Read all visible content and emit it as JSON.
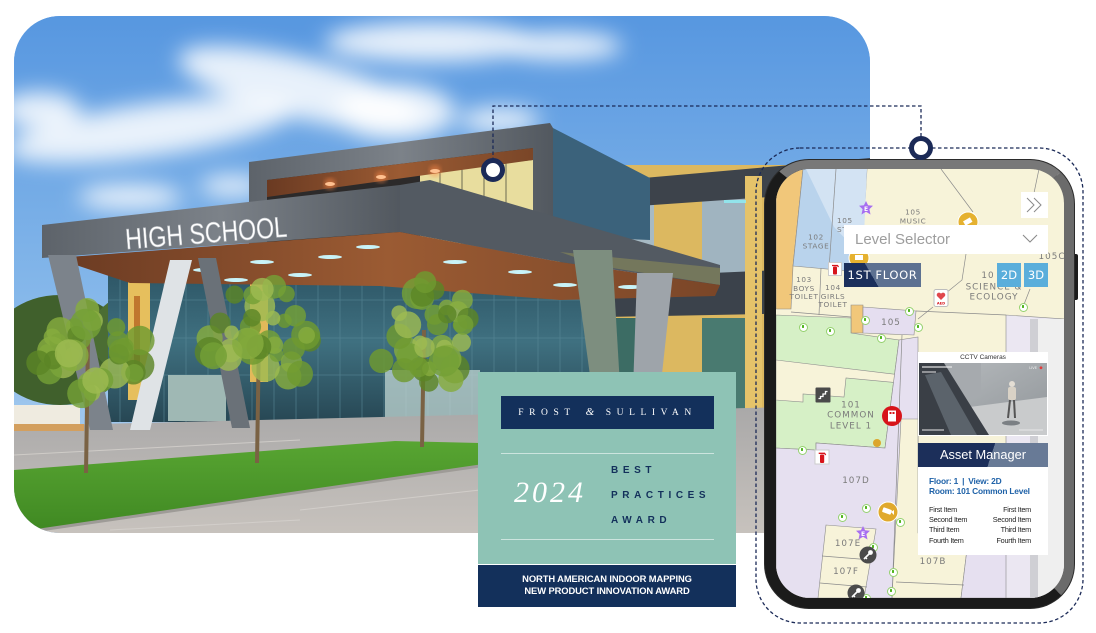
{
  "colors": {
    "navy": "#13305b",
    "award_teal": "#8ec3b5",
    "map_blue": "#5aaedb",
    "connector": "#1b2a57"
  },
  "photo": {
    "sign_text": "HIGH SCHOOL"
  },
  "award": {
    "brand": {
      "left": "FROST",
      "amp": "&",
      "right": "SULLIVAN"
    },
    "year": "2024",
    "title_lines": [
      "BEST",
      "PRACTICES",
      "AWARD"
    ],
    "category_lines": [
      "NORTH AMERICAN INDOOR MAPPING",
      "NEW PRODUCT INNOVATION AWARD"
    ]
  },
  "phone": {
    "level_selector": {
      "placeholder": "Level Selector"
    },
    "current_floor": "1ST FLOOR",
    "view_toggle": [
      {
        "label": "2D"
      },
      {
        "label": "3D"
      }
    ],
    "map": {
      "rooms": [
        {
          "label": "102\nSTAGE"
        },
        {
          "label": "105\nST"
        },
        {
          "label": "105\nMUSIC"
        },
        {
          "label": "103\nBOYS\nTOILET"
        },
        {
          "label": "104\nGIRLS\nTOILET"
        },
        {
          "label": "10"
        },
        {
          "label": "SCIENCE &\nECOLOGY"
        },
        {
          "label": "105C"
        },
        {
          "label": "105"
        },
        {
          "label": "101\nCOMMON\nLEVEL 1"
        },
        {
          "label": "107D"
        },
        {
          "label": "107E"
        },
        {
          "label": "107F"
        },
        {
          "label": "107B"
        }
      ],
      "icon_letters": {
        "elevator": "E",
        "aed": "AED"
      }
    },
    "cctv": {
      "title": "CCTV Cameras",
      "status": "LIVE"
    },
    "asset_manager": {
      "title": "Asset Manager",
      "floor": "Floor: 1",
      "separator": "|",
      "view": "View: 2D",
      "room": "Room: 101 Common Level",
      "items": [
        {
          "left": "First Item",
          "right": "First Item"
        },
        {
          "left": "Second Item",
          "right": "Second Item"
        },
        {
          "left": "Third Item",
          "right": "Third Item"
        },
        {
          "left": "Fourth Item",
          "right": "Fourth Item"
        }
      ]
    }
  }
}
